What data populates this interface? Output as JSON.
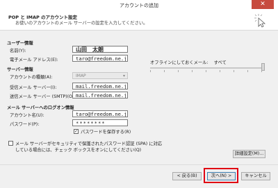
{
  "window": {
    "title": "アカウントの追加",
    "close_glyph": "✕"
  },
  "header": {
    "title": "POP と IMAP のアカウント設定",
    "subtitle": "お使いのアカウントのメール サーバーの設定を入力してください。",
    "icon": "cursor-arrow-icon"
  },
  "user_info": {
    "heading": "ユーザー情報",
    "name_label": "名前(Y):",
    "name_value": "山田　太朗",
    "email_label": "電子メール アドレス(E):",
    "email_value": "taro@freedom.ne.jp"
  },
  "server_info": {
    "heading": "サーバー情報",
    "account_type_label": "アカウントの種類(A):",
    "account_type_value": "IMAP",
    "incoming_label": "受信メール サーバー(I):",
    "incoming_value": "mail.freedom.ne.jp",
    "outgoing_label": "送信メール サーバー (SMTP)(O):",
    "outgoing_value": "mail.freedom.ne.jp"
  },
  "logon_info": {
    "heading": "メール サーバーへのログオン情報",
    "account_name_label": "アカウント名(U):",
    "account_name_value": "taro@freedom.ne.jp",
    "password_label": "パスワード(P):",
    "password_value": "********",
    "remember_label": "パスワードを保存する(R)",
    "remember_checked": true
  },
  "spa": {
    "label_line1": "メール サーバーがセキュリティで保護されたパスワード認証 (SPA) に対応",
    "label_line2": "している場合には、チェック ボックスをオンにしてください(Q)",
    "checked": false
  },
  "offline": {
    "label": "オフラインにしておくメール:",
    "value": "すべて",
    "fraction": 1.0
  },
  "buttons": {
    "more_settings": "詳細設定(M)...",
    "back": "< 戻る(B)",
    "next": "次へ(N) >",
    "cancel": "キャンセル"
  },
  "colors": {
    "close": "#c74b3f",
    "highlight": "#e00012",
    "next_border": "#3c7fb1"
  }
}
